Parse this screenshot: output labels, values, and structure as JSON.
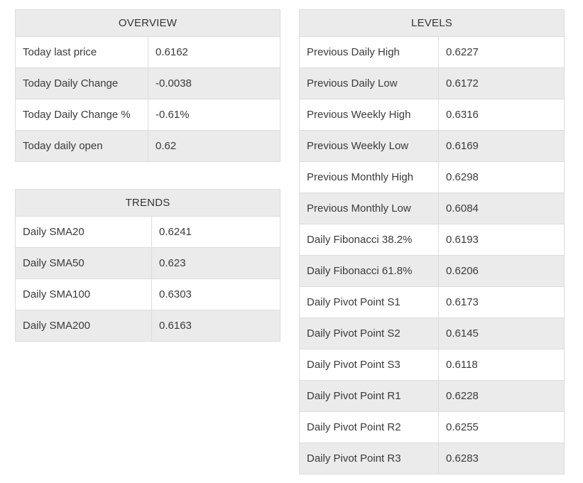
{
  "overview": {
    "title": "OVERVIEW",
    "rows": [
      {
        "label": "Today last price",
        "value": "0.6162"
      },
      {
        "label": "Today Daily Change",
        "value": "-0.0038"
      },
      {
        "label": "Today Daily Change %",
        "value": "-0.61%"
      },
      {
        "label": "Today daily open",
        "value": "0.62"
      }
    ]
  },
  "trends": {
    "title": "TRENDS",
    "rows": [
      {
        "label": "Daily SMA20",
        "value": "0.6241"
      },
      {
        "label": "Daily SMA50",
        "value": "0.623"
      },
      {
        "label": "Daily SMA100",
        "value": "0.6303"
      },
      {
        "label": "Daily SMA200",
        "value": "0.6163"
      }
    ]
  },
  "levels": {
    "title": "LEVELS",
    "rows": [
      {
        "label": "Previous Daily High",
        "value": "0.6227"
      },
      {
        "label": "Previous Daily Low",
        "value": "0.6172"
      },
      {
        "label": "Previous Weekly High",
        "value": "0.6316"
      },
      {
        "label": "Previous Weekly Low",
        "value": "0.6169"
      },
      {
        "label": "Previous Monthly High",
        "value": "0.6298"
      },
      {
        "label": "Previous Monthly Low",
        "value": "0.6084"
      },
      {
        "label": "Daily Fibonacci 38.2%",
        "value": "0.6193"
      },
      {
        "label": "Daily Fibonacci 61.8%",
        "value": "0.6206"
      },
      {
        "label": "Daily Pivot Point S1",
        "value": "0.6173"
      },
      {
        "label": "Daily Pivot Point S2",
        "value": "0.6145"
      },
      {
        "label": "Daily Pivot Point S3",
        "value": "0.6118"
      },
      {
        "label": "Daily Pivot Point R1",
        "value": "0.6228"
      },
      {
        "label": "Daily Pivot Point R2",
        "value": "0.6255"
      },
      {
        "label": "Daily Pivot Point R3",
        "value": "0.6283"
      }
    ]
  }
}
